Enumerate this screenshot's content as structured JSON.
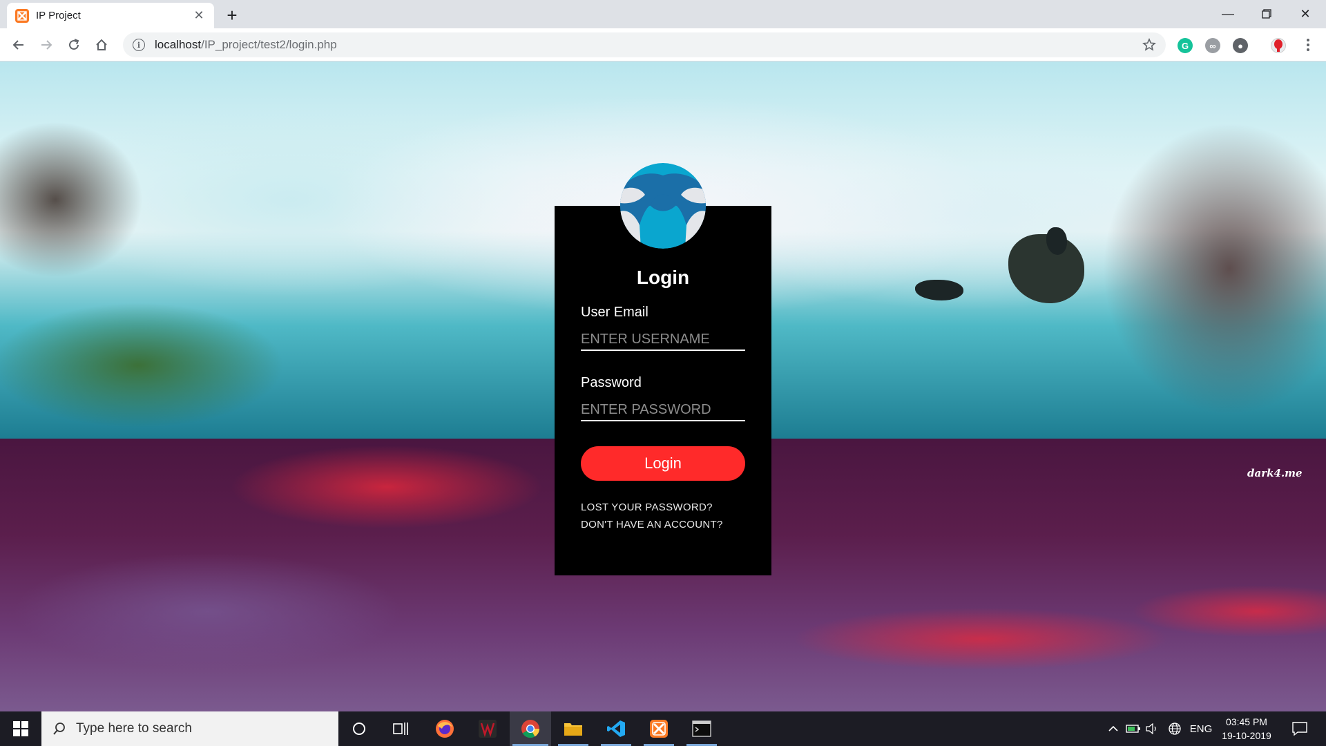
{
  "browser": {
    "tab_title": "IP Project",
    "url_host": "localhost",
    "url_path": "/IP_project/test2/login.php"
  },
  "page": {
    "login_title": "Login",
    "email_label": "User Email",
    "email_placeholder": "ENTER USERNAME",
    "password_label": "Password",
    "password_placeholder": "ENTER PASSWORD",
    "login_button": "Login",
    "lost_password_link": "LOST YOUR PASSWORD?",
    "no_account_link": "DON'T HAVE AN ACCOUNT?",
    "watermark": "dark4.me"
  },
  "taskbar": {
    "search_placeholder": "Type here to search",
    "language": "ENG",
    "time": "03:45 PM",
    "date": "19-10-2019"
  },
  "colors": {
    "login_button": "#ff2a2a",
    "panel": "#000000",
    "avatar_blue": "#0aa6cf"
  }
}
